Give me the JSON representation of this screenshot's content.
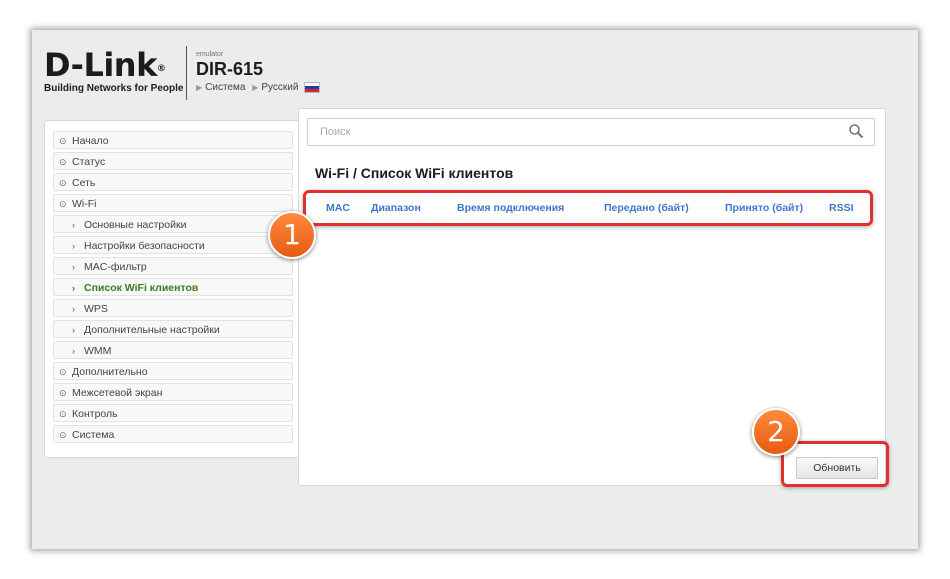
{
  "brand": {
    "logo": "D-Link",
    "registered": "®",
    "tagline": "Building Networks for People",
    "emulator": "emulator",
    "model": "DIR-615",
    "crumb_system": "Система",
    "crumb_language": "Русский"
  },
  "search": {
    "placeholder": "Поиск"
  },
  "sidebar": {
    "items": [
      {
        "label": "Начало"
      },
      {
        "label": "Статус"
      },
      {
        "label": "Сеть"
      },
      {
        "label": "Wi-Fi"
      },
      {
        "label": "Основные настройки"
      },
      {
        "label": "Настройки безопасности"
      },
      {
        "label": "MAC-фильтр"
      },
      {
        "label": "Список WiFi клиентов"
      },
      {
        "label": "WPS"
      },
      {
        "label": "Дополнительные настройки"
      },
      {
        "label": "WMM"
      },
      {
        "label": "Дополнительно"
      },
      {
        "label": "Межсетевой экран"
      },
      {
        "label": "Контроль"
      },
      {
        "label": "Система"
      }
    ]
  },
  "main": {
    "title": "Wi-Fi /  Список WiFi клиентов",
    "columns": [
      "MAC",
      "Диапазон",
      "Время подключения",
      "Передано (байт)",
      "Принято (байт)",
      "RSSI"
    ],
    "refresh_label": "Обновить"
  },
  "annotations": {
    "badge1": "1",
    "badge2": "2"
  },
  "colors": {
    "accent_link": "#3d78c6",
    "highlight": "#e03030",
    "active_item": "#3a7a1e",
    "badge": "#f07020"
  }
}
